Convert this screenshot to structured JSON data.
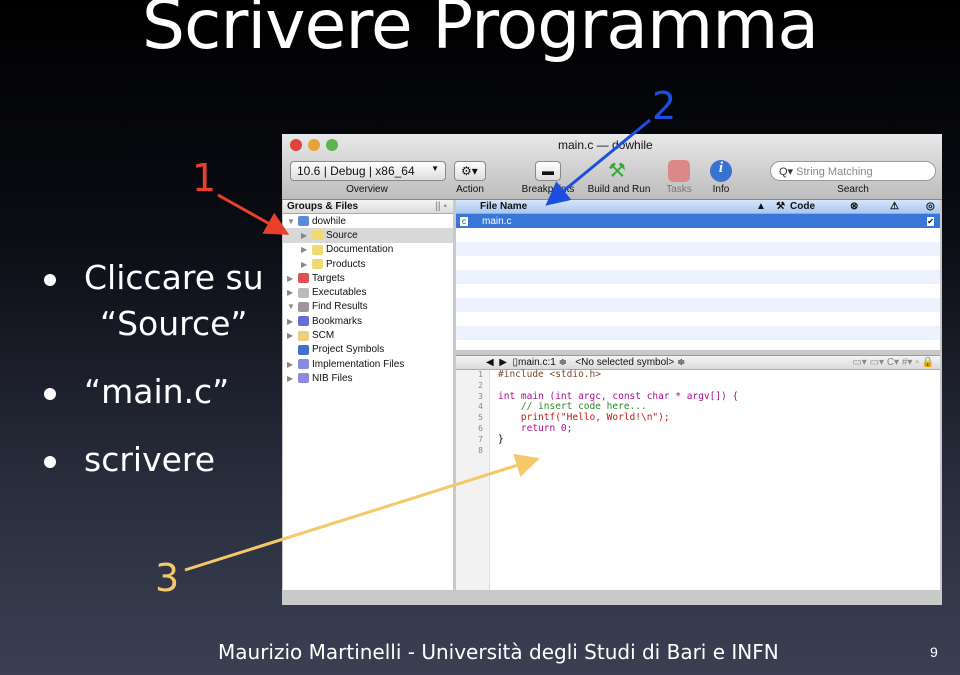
{
  "slide": {
    "title": "Scrivere Programma",
    "bullets": [
      "Cliccare su",
      "“Source”",
      "“main.c”",
      "scrivere"
    ],
    "footer": "Maurizio Martinelli - Università degli Studi di Bari e INFN",
    "page": "9",
    "annotations": [
      "1",
      "2",
      "3"
    ],
    "colors": {
      "ann1": "#e8402a",
      "ann2": "#1b4fe0",
      "ann3": "#f5c86a"
    }
  },
  "window": {
    "title": "main.c — dowhile",
    "toolbar": {
      "scheme": "10.6 | Debug | x86_64",
      "overview": "Overview",
      "action": "Action",
      "breakpoints": "Breakpoints",
      "build": "Build and Run",
      "tasks": "Tasks",
      "info": "Info",
      "search_placeholder": "String Matching",
      "search": "Search"
    },
    "sidebar": {
      "header": "Groups & Files",
      "items": [
        {
          "label": "dowhile",
          "icon": "project-icon",
          "level": 0,
          "open": true
        },
        {
          "label": "Source",
          "icon": "folder-icon",
          "level": 1,
          "selected": true
        },
        {
          "label": "Documentation",
          "icon": "folder-icon",
          "level": 1
        },
        {
          "label": "Products",
          "icon": "folder-icon",
          "level": 1
        },
        {
          "label": "Targets",
          "icon": "target-icon",
          "level": 0
        },
        {
          "label": "Executables",
          "icon": "executable-icon",
          "level": 0
        },
        {
          "label": "Find Results",
          "icon": "magnifier-icon",
          "level": 0,
          "open": true
        },
        {
          "label": "Bookmarks",
          "icon": "book-icon",
          "level": 0
        },
        {
          "label": "SCM",
          "icon": "database-icon",
          "level": 0
        },
        {
          "label": "Project Symbols",
          "icon": "cube-icon",
          "level": 0,
          "nochev": true
        },
        {
          "label": "Implementation Files",
          "icon": "smart-folder-icon",
          "level": 0
        },
        {
          "label": "NIB Files",
          "icon": "smart-folder-icon",
          "level": 0
        }
      ]
    },
    "filelist": {
      "columns": [
        "File Name",
        "Code"
      ],
      "rows": [
        {
          "name": "main.c",
          "checked": true
        }
      ]
    },
    "editor": {
      "file": "main.c:1 ≑",
      "symbol": "<No selected symbol> ≑",
      "lines": [
        "#include <stdio.h>",
        "",
        "int main (int argc, const char * argv[]) {",
        "    // insert code here...",
        "    printf(\"Hello, World!\\n\");",
        "    return 0;",
        "}",
        ""
      ]
    }
  }
}
